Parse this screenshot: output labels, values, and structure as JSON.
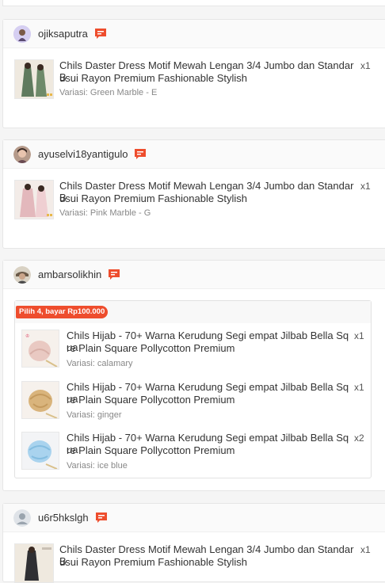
{
  "orders": [
    {
      "username": "ojiksaputra",
      "items": [
        {
          "title": "Chils Daster Dress Motif Mewah Lengan 3/4 Jumbo dan Standar Busui Rayon Premium Fashionable Stylish",
          "title_line1": "Chils Daster Dress Motif Mewah Lengan 3/4 Jumbo dan Standar B",
          "title_line2": "usui Rayon Premium Fashionable Stylish",
          "variation": "Variasi: Green Marble - E",
          "qty": "x1"
        }
      ]
    },
    {
      "username": "ayuselvi18yantigulo",
      "items": [
        {
          "title": "Chils Daster Dress Motif Mewah Lengan 3/4 Jumbo dan Standar Busui Rayon Premium Fashionable Stylish",
          "title_line1": "Chils Daster Dress Motif Mewah Lengan 3/4 Jumbo dan Standar B",
          "title_line2": "usui Rayon Premium Fashionable Stylish",
          "variation": "Variasi: Pink Marble - G",
          "qty": "x1"
        }
      ]
    },
    {
      "username": "ambarsolikhin",
      "bundle_label": "Pilih 4, bayar Rp100.000",
      "items": [
        {
          "title_line1": "Chils Hijab - 70+ Warna Kerudung Segi empat Jilbab Bella Squa",
          "title_line2": "re Plain Square Pollycotton Premium",
          "variation": "Variasi: calamary",
          "qty": "x1"
        },
        {
          "title_line1": "Chils Hijab - 70+ Warna Kerudung Segi empat Jilbab Bella Squa",
          "title_line2": "re Plain Square Pollycotton Premium",
          "variation": "Variasi: ginger",
          "qty": "x1"
        },
        {
          "title_line1": "Chils Hijab - 70+ Warna Kerudung Segi empat Jilbab Bella Squa",
          "title_line2": "re Plain Square Pollycotton Premium",
          "variation": "Variasi: ice blue",
          "qty": "x2"
        }
      ]
    },
    {
      "username": "u6r5hkslgh",
      "items": [
        {
          "title_line1": "Chils Daster Dress Motif Mewah Lengan 3/4 Jumbo dan Standar B",
          "title_line2": "usui Rayon Premium Fashionable Stylish",
          "qty": "x1"
        }
      ]
    }
  ],
  "colors": {
    "accent": "#ee4d2d",
    "chat_icon": "#ee4d2d"
  }
}
